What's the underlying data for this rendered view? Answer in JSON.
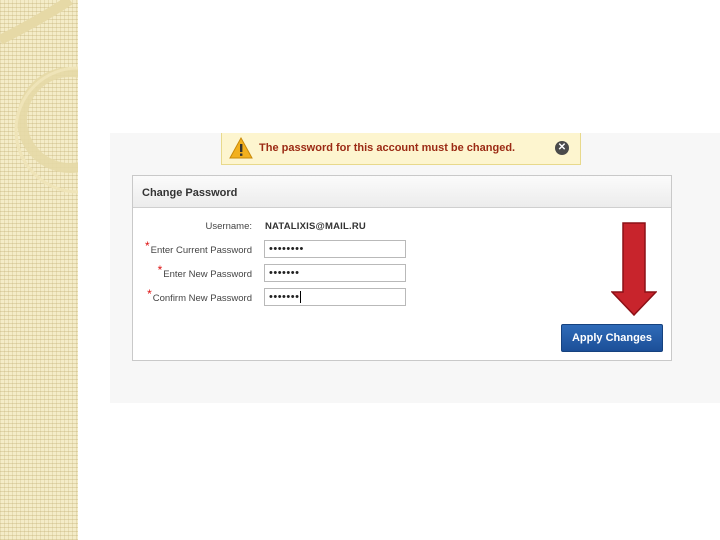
{
  "alert": {
    "message": "The password for this account must be changed.",
    "icon": "warning-triangle-icon",
    "close_icon": "close-icon"
  },
  "panel": {
    "title": "Change Password",
    "fields": [
      {
        "label": "Username",
        "value": "NATALIXIS@MAIL.RU",
        "required": false
      },
      {
        "label": "Enter Current Password",
        "value": "••••••••",
        "required": true
      },
      {
        "label": "Enter New Password",
        "value": "•••••••",
        "required": true
      },
      {
        "label": "Confirm New Password",
        "value": "•••••••",
        "required": true
      }
    ],
    "required_marker": "*",
    "apply_label": "Apply Changes"
  },
  "colors": {
    "alert_text": "#9b2a14",
    "button": "#2360ae",
    "arrow": "#c8242c"
  }
}
